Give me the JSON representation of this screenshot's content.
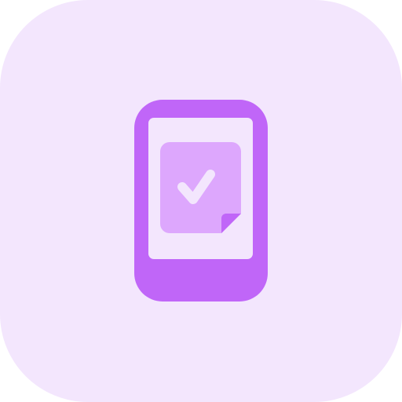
{
  "icon": {
    "name": "mobile-checklist-icon",
    "colors": {
      "background": "#F3E6FD",
      "device": "#C066F8",
      "screen": "#F3E6FD",
      "note": "#DDA7FD",
      "check": "#F3E6FD"
    }
  }
}
